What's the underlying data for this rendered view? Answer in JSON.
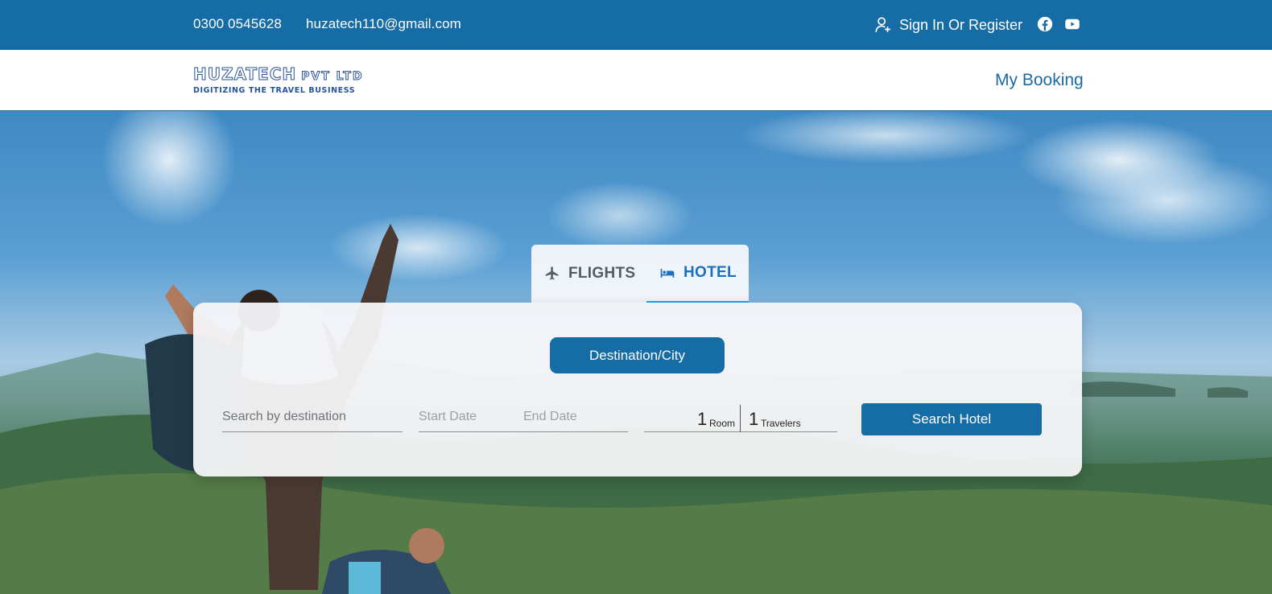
{
  "topbar": {
    "phone": "0300 0545628",
    "email": "huzatech110@gmail.com",
    "signin_label": "Sign In Or Register",
    "social_icons": [
      "facebook-icon",
      "youtube-icon"
    ],
    "background": "#166ca4"
  },
  "header": {
    "logo": {
      "title": "HUZATECH",
      "title_suffix": "PVT LTD",
      "tagline": "DIGITIZING THE TRAVEL BUSINESS"
    },
    "nav_label": "My Booking"
  },
  "search": {
    "tabs": [
      {
        "label": "FLIGHTS",
        "icon": "airplane-icon",
        "active": false
      },
      {
        "label": "HOTEL",
        "icon": "bed-icon",
        "active": true
      }
    ],
    "mode_button": "Destination/City",
    "destination_placeholder": "Search by destination",
    "start_date_placeholder": "Start Date",
    "end_date_placeholder": "End Date",
    "rooms": {
      "value": "1",
      "label": "Room"
    },
    "travelers": {
      "value": "1",
      "label": "Travelers"
    },
    "submit_label": "Search Hotel"
  },
  "colors": {
    "brand": "#166ca4",
    "tab_active": "#1b6fbf",
    "tab_underline": "#22a3e6"
  }
}
